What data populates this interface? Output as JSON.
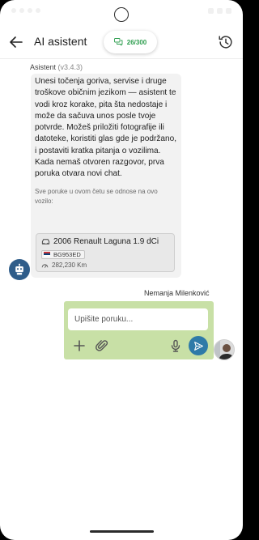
{
  "app_bar": {
    "title": "AI asistent",
    "quota": "26/300",
    "accent": "#2e9e4f"
  },
  "icons": {
    "back": "arrow-left-icon",
    "quota": "chat-bubbles-icon",
    "history": "history-icon",
    "bot": "robot-icon",
    "car": "car-icon",
    "plate_flag": "serbia-flag-icon",
    "odometer": "speedometer-icon",
    "add": "plus-icon",
    "attach": "paperclip-icon",
    "mic": "microphone-icon",
    "send": "send-icon"
  },
  "assistant": {
    "name": "Asistent",
    "version": "(v3.4.3)",
    "message": "Unesi točenja goriva, servise i druge troškove običnim jezikom — asistent te vodi kroz korake, pita šta nedostaje i može da sačuva unos posle tvoje potvrde. Možeš priložiti fotografije ili datoteke, koristiti glas gde je podržano, i postaviti kratka pitanja o vozilima. Kada nemaš otvoren razgovor, prva poruka otvara novi chat.",
    "note": "Sve poruke u ovom četu se odnose na ovo vozilo:",
    "vehicle": {
      "title": "2006 Renault Laguna 1.9 dCi",
      "plate": "BG953ED",
      "mileage": "282,230 Km"
    }
  },
  "user": {
    "name": "Nemanja Milenković"
  },
  "composer": {
    "placeholder": "Upišite poruku..."
  },
  "colors": {
    "composer_bg": "#c8e0a6",
    "send_button": "#2e7aa8",
    "bot_avatar": "#2f5d8a",
    "bubble_bg": "#f2f2f2"
  }
}
